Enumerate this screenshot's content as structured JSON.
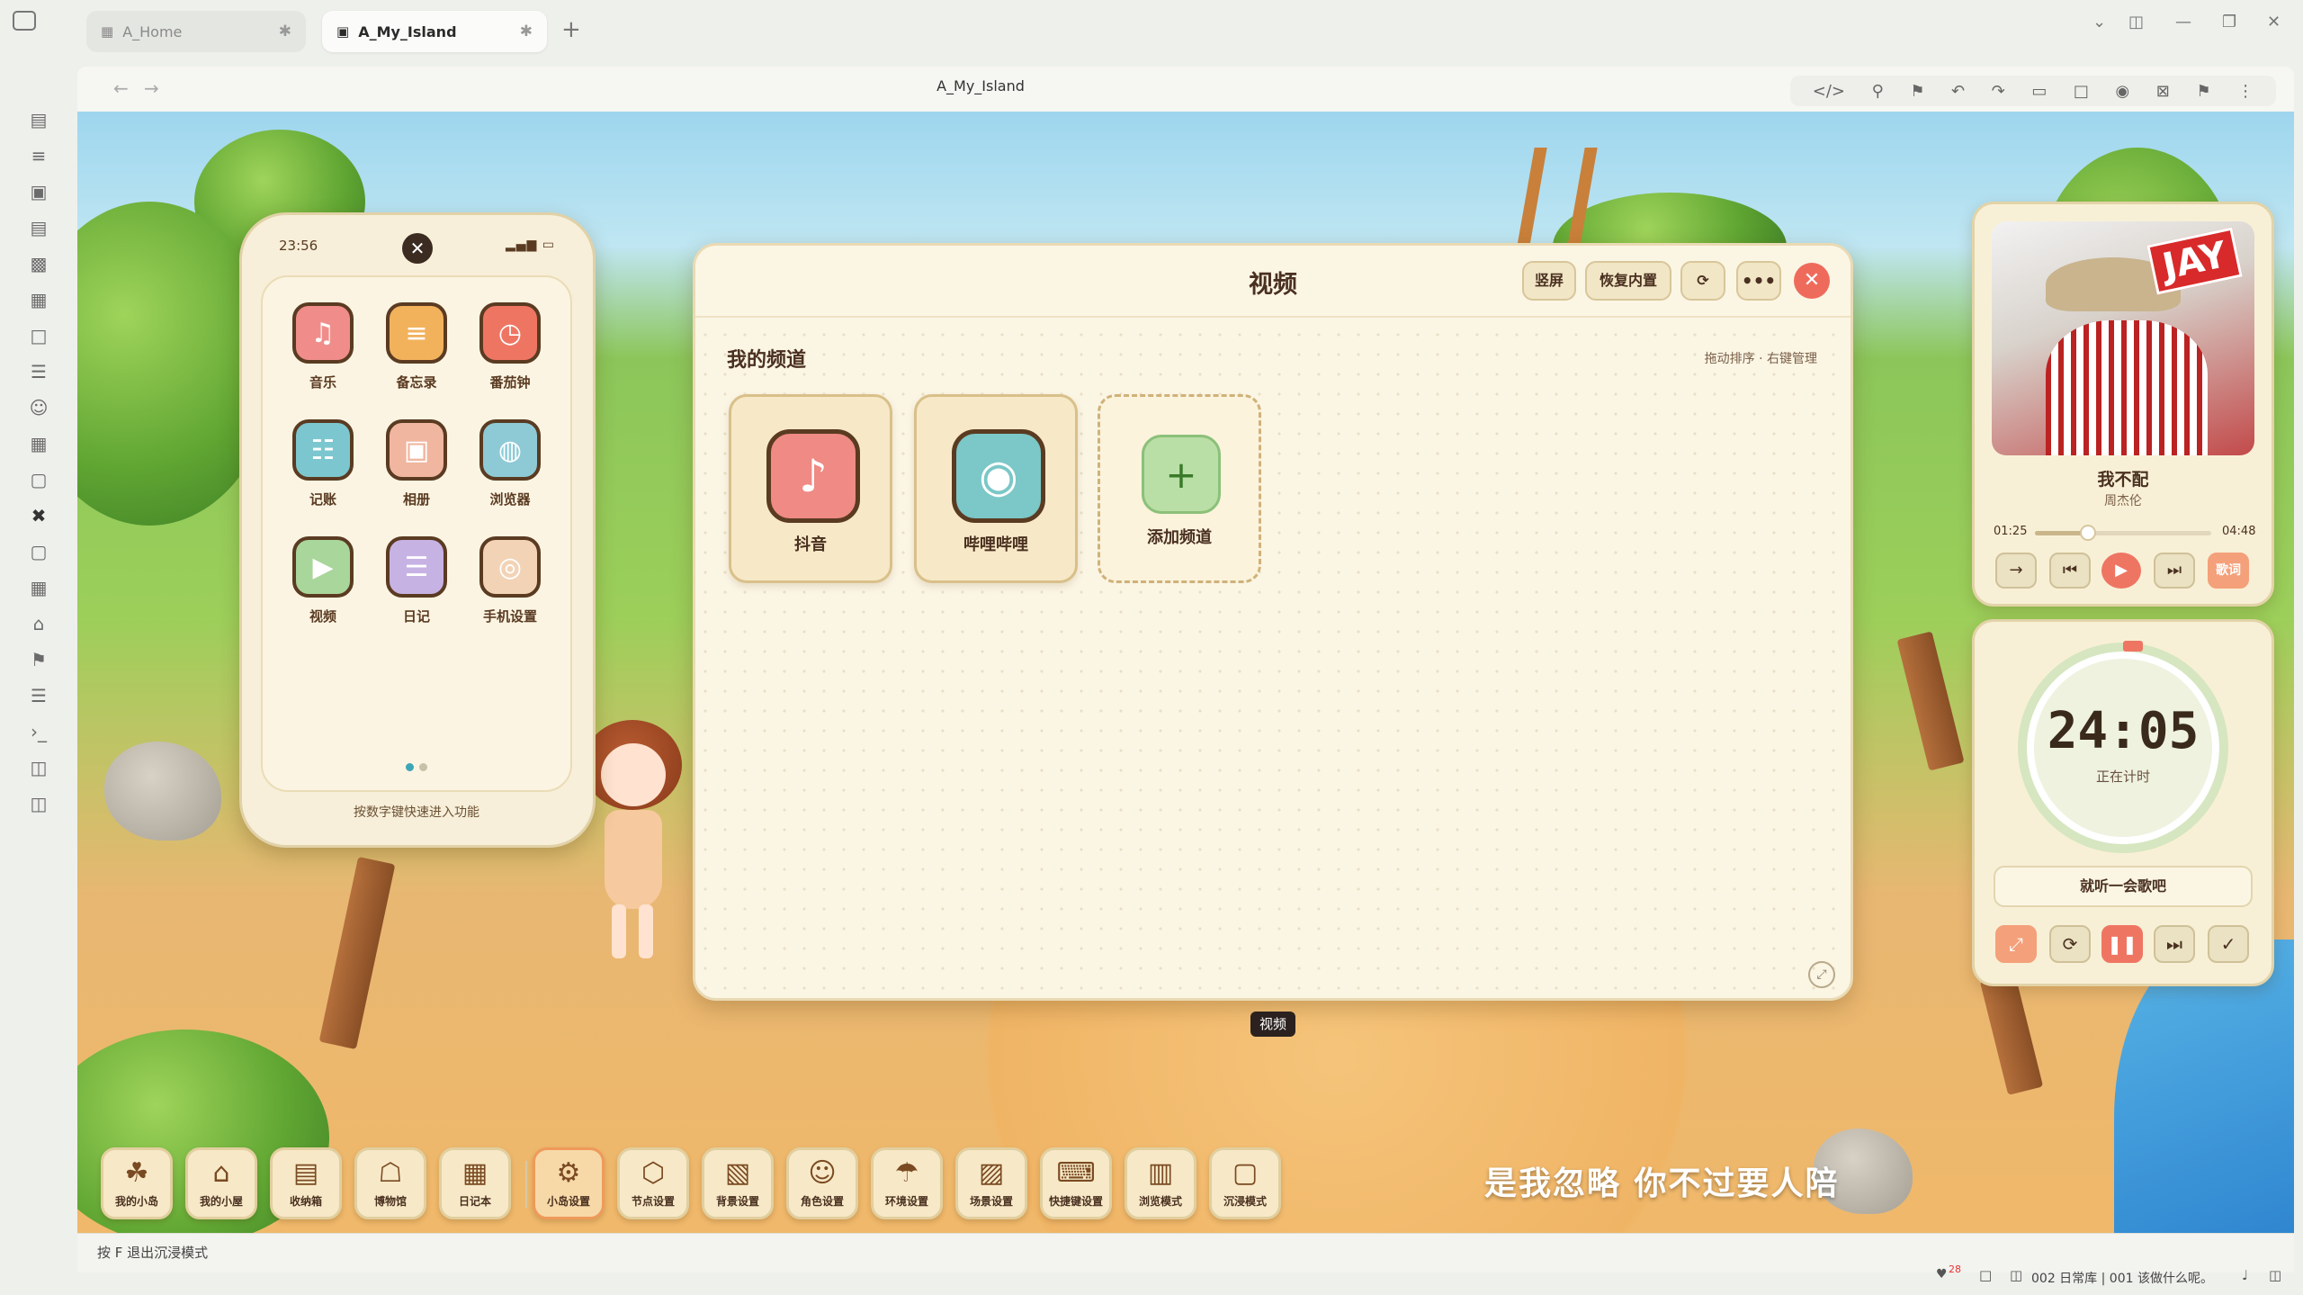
{
  "tabs": [
    {
      "label": "A_Home",
      "active": false
    },
    {
      "label": "A_My_Island",
      "active": true
    }
  ],
  "nav": {
    "title": "A_My_Island"
  },
  "phone": {
    "time": "23:56",
    "signal": "▂▄▆ ▭",
    "apps": [
      {
        "label": "音乐",
        "icon": "music-icon",
        "color": "#f08d8a",
        "glyph": "♫"
      },
      {
        "label": "备忘录",
        "icon": "memo-icon",
        "color": "#f2b25c",
        "glyph": "≡"
      },
      {
        "label": "番茄钟",
        "icon": "tomato-clock-icon",
        "color": "#ef7563",
        "glyph": "◷"
      },
      {
        "label": "记账",
        "icon": "calculator-icon",
        "color": "#7cc7cf",
        "glyph": "☷"
      },
      {
        "label": "相册",
        "icon": "photo-album-icon",
        "color": "#f0b6a0",
        "glyph": "▣"
      },
      {
        "label": "浏览器",
        "icon": "globe-icon",
        "color": "#8dcad6",
        "glyph": "◍"
      },
      {
        "label": "视频",
        "icon": "video-play-icon",
        "color": "#a9d69a",
        "glyph": "▶"
      },
      {
        "label": "日记",
        "icon": "diary-icon",
        "color": "#c7b2e4",
        "glyph": "☰"
      },
      {
        "label": "手机设置",
        "icon": "phone-settings-icon",
        "color": "#f3d3b6",
        "glyph": "◎"
      }
    ],
    "hint": "按数字键快速进入功能"
  },
  "panel": {
    "title": "视频",
    "btn_portrait": "竖屏",
    "btn_restore": "恢复内置",
    "channels_title": "我的频道",
    "channels_hint": "拖动排序 · 右键管理",
    "channels": [
      {
        "label": "抖音",
        "icon": "douyin-icon",
        "color": "#ef8a84"
      },
      {
        "label": "哔哩哔哩",
        "icon": "bilibili-icon",
        "color": "#7cc7c7"
      }
    ],
    "add_label": "添加频道",
    "tooltip": "视频"
  },
  "music": {
    "cover_text": "JAY",
    "song": "我不配",
    "artist": "周杰伦",
    "current": "01:25",
    "duration": "04:48",
    "progress": 0.3,
    "lyric_btn": "歌词"
  },
  "timer": {
    "time": "24:05",
    "status": "正在计时",
    "task": "就听一会歌吧"
  },
  "dock": [
    {
      "label": "我的小岛",
      "icon": "island-icon",
      "glyph": "☘"
    },
    {
      "label": "我的小屋",
      "icon": "house-icon",
      "glyph": "⌂"
    },
    {
      "label": "收纳箱",
      "icon": "storage-box-icon",
      "glyph": "▤"
    },
    {
      "label": "博物馆",
      "icon": "museum-icon",
      "glyph": "☖"
    },
    {
      "label": "日记本",
      "icon": "notebook-icon",
      "glyph": "▦"
    },
    {
      "label": "小岛设置",
      "icon": "island-settings-icon",
      "glyph": "⚙"
    },
    {
      "label": "节点设置",
      "icon": "node-settings-icon",
      "glyph": "⬡"
    },
    {
      "label": "背景设置",
      "icon": "background-settings-icon",
      "glyph": "▧"
    },
    {
      "label": "角色设置",
      "icon": "character-settings-icon",
      "glyph": "☺"
    },
    {
      "label": "环境设置",
      "icon": "weather-icon",
      "glyph": "☂"
    },
    {
      "label": "场景设置",
      "icon": "scene-settings-icon",
      "glyph": "▨"
    },
    {
      "label": "快捷键设置",
      "icon": "keyboard-icon",
      "glyph": "⌨"
    },
    {
      "label": "浏览模式",
      "icon": "map-icon",
      "glyph": "▥"
    },
    {
      "label": "沉浸模式",
      "icon": "immersive-icon",
      "glyph": "▢"
    }
  ],
  "lyric": "是我忽略 你不过要人陪",
  "status": {
    "exit_hint": "按 F 退出沉浸模式",
    "right": "002 日常库 | 001 该做什么呢。",
    "badge": "28"
  }
}
